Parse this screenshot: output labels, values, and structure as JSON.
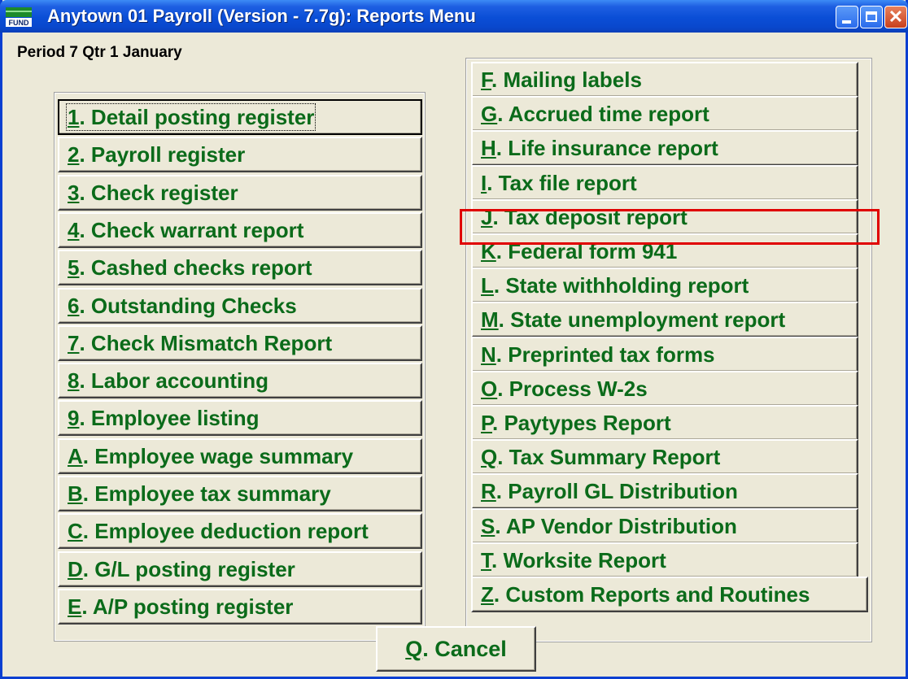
{
  "window": {
    "title": "Anytown 01 Payroll (Version - 7.7g):  Reports Menu",
    "close_glyph": "✕"
  },
  "period_label": "Period 7 Qtr 1 January",
  "left_menu": [
    {
      "key": "1",
      "rest": ". Detail posting register"
    },
    {
      "key": "2",
      "rest": ".  Payroll register"
    },
    {
      "key": "3",
      "rest": ". Check register"
    },
    {
      "key": "4",
      "rest": ". Check warrant report"
    },
    {
      "key": "5",
      "rest": ". Cashed checks report"
    },
    {
      "key": "6",
      "rest": ". Outstanding Checks"
    },
    {
      "key": "7",
      "rest": ". Check Mismatch Report"
    },
    {
      "key": "8",
      "rest": ". Labor accounting"
    },
    {
      "key": "9",
      "rest": ".  Employee listing"
    },
    {
      "key": "A",
      "rest": ". Employee wage summary"
    },
    {
      "key": "B",
      "rest": ". Employee tax summary"
    },
    {
      "key": "C",
      "rest": ". Employee deduction report"
    },
    {
      "key": "D",
      "rest": ". G/L posting register"
    },
    {
      "key": "E",
      "rest": ". A/P posting register"
    }
  ],
  "right_menu": [
    {
      "key": "F",
      "rest": ".  Mailing labels"
    },
    {
      "key": "G",
      "rest": ". Accrued time report"
    },
    {
      "key": "H",
      "rest": ". Life insurance report"
    },
    {
      "key": "I",
      "rest": ". Tax file report"
    },
    {
      "key": "J",
      "rest": ". Tax deposit report"
    },
    {
      "key": "K",
      "rest": ". Federal form 941"
    },
    {
      "key": "L",
      "rest": ". State withholding report"
    },
    {
      "key": "M",
      "rest": ". State unemployment report"
    },
    {
      "key": "N",
      "rest": ". Preprinted tax forms"
    },
    {
      "key": "O",
      "rest": ". Process W-2s"
    },
    {
      "key": "P",
      "rest": ".  Paytypes Report"
    },
    {
      "key": "Q",
      "rest": ". Tax Summary Report"
    },
    {
      "key": "R",
      "rest": ". Payroll GL Distribution"
    },
    {
      "key": "S",
      "rest": ". AP Vendor Distribution"
    },
    {
      "key": "T",
      "rest": ". Worksite Report"
    },
    {
      "key": "Z",
      "rest": ". Custom Reports and Routines"
    }
  ],
  "cancel": {
    "key": "Q",
    "rest": ". Cancel"
  },
  "colors": {
    "button_text": "#0b6b1a",
    "highlight": "#e00000",
    "titlebar": "#0a4ed6"
  }
}
